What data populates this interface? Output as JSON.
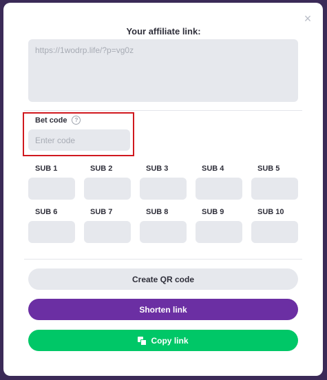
{
  "modal": {
    "close_symbol": "×",
    "title": "Your affiliate link:",
    "affiliate_link": "https://1wodrp.life/?p=vg0z"
  },
  "bet_code": {
    "label": "Bet code",
    "help_symbol": "?",
    "placeholder": "Enter code",
    "value": ""
  },
  "subs": [
    {
      "label": "SUB 1"
    },
    {
      "label": "SUB 2"
    },
    {
      "label": "SUB 3"
    },
    {
      "label": "SUB 4"
    },
    {
      "label": "SUB 5"
    },
    {
      "label": "SUB 6"
    },
    {
      "label": "SUB 7"
    },
    {
      "label": "SUB 8"
    },
    {
      "label": "SUB 9"
    },
    {
      "label": "SUB 10"
    }
  ],
  "buttons": {
    "create_qr": "Create QR code",
    "shorten": "Shorten link",
    "copy": "Copy link"
  },
  "colors": {
    "accent_purple": "#6b2fa3",
    "accent_green": "#00c767",
    "highlight_red": "#d0181e",
    "backdrop": "#3b2a57"
  },
  "icons": {
    "close": "close-icon",
    "help": "question-circle-icon",
    "copy": "copy-icon"
  }
}
